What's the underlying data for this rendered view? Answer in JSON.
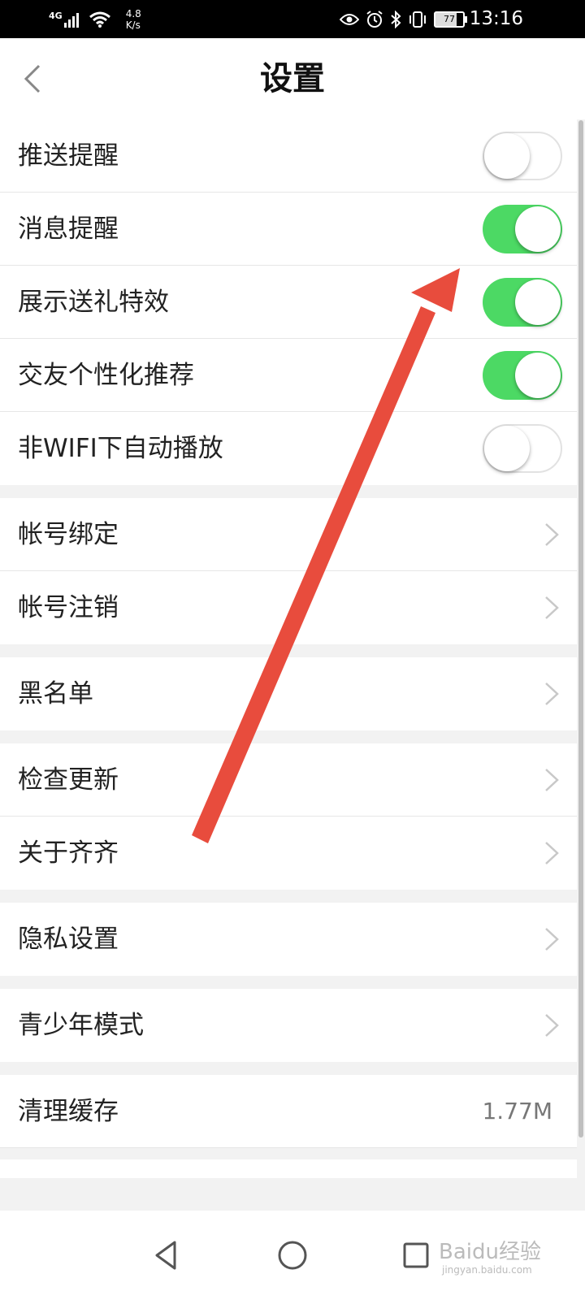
{
  "status_bar": {
    "network": "4G",
    "speed_value": "4.8",
    "speed_unit": "K/s",
    "battery": "77",
    "time": "13:16"
  },
  "header": {
    "title": "设置"
  },
  "toggles": [
    {
      "label": "推送提醒",
      "on": false
    },
    {
      "label": "消息提醒",
      "on": true
    },
    {
      "label": "展示送礼特效",
      "on": true
    },
    {
      "label": "交友个性化推荐",
      "on": true
    },
    {
      "label": "非WIFI下自动播放",
      "on": false
    }
  ],
  "account": {
    "bind_label": "帐号绑定",
    "cancel_label": "帐号注销"
  },
  "blacklist_label": "黑名单",
  "about": {
    "update_label": "检查更新",
    "about_label": "关于齐齐"
  },
  "privacy_label": "隐私设置",
  "youth_label": "青少年模式",
  "cache": {
    "label": "清理缓存",
    "value": "1.77M"
  },
  "watermark": {
    "brand": "Baidu经验",
    "url": "jingyan.baidu.com"
  },
  "colors": {
    "toggle_on": "#4cd964",
    "annotation_arrow": "#e84c3d"
  }
}
